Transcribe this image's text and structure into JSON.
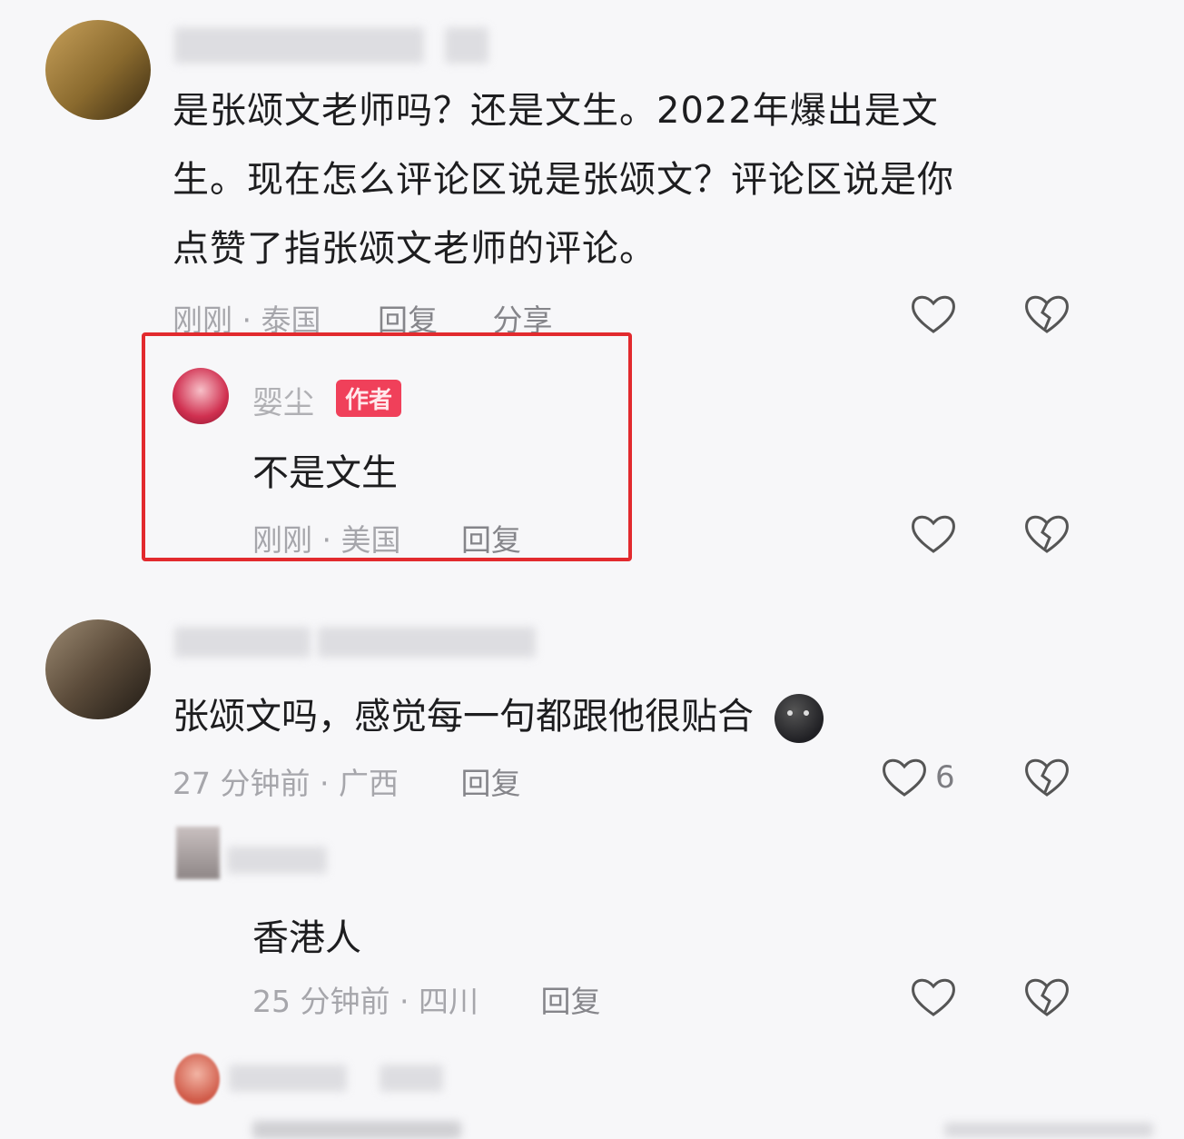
{
  "comments": [
    {
      "text_lines": [
        "是张颂文老师吗？还是文生。2022年爆出是文",
        "生。现在怎么评论区说是张颂文？评论区说是你",
        "点赞了指张颂文老师的评论。"
      ],
      "time": "刚刚",
      "location": "泰国",
      "reply_label": "回复",
      "share_label": "分享"
    },
    {
      "username": "婴尘",
      "badge": "作者",
      "text": "不是文生",
      "time": "刚刚",
      "location": "美国",
      "reply_label": "回复"
    },
    {
      "text": "张颂文吗，感觉每一句都跟他很贴合",
      "time": "27 分钟前",
      "location": "广西",
      "reply_label": "回复",
      "like_count": "6"
    },
    {
      "text": "香港人",
      "time": "25 分钟前",
      "location": "四川",
      "reply_label": "回复"
    }
  ],
  "icons": {
    "like": "heart-outline-icon",
    "dislike": "broken-heart-icon",
    "emoji": "black-face-emoji-icon"
  },
  "colors": {
    "highlight": "#e22a2e",
    "badge": "#f0405a"
  }
}
